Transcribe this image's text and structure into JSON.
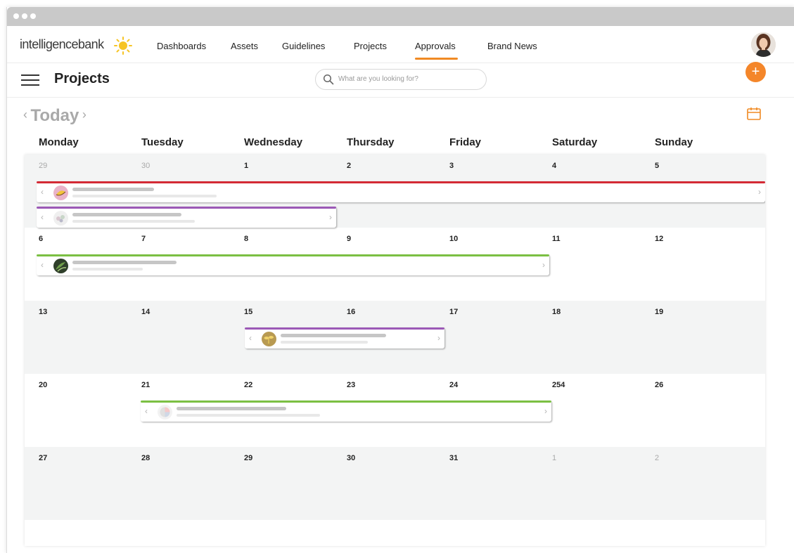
{
  "brand": {
    "name": "intelligencebank",
    "accent": "#f08a24",
    "sun_color": "#f6c423"
  },
  "nav": {
    "items": [
      {
        "label": "Dashboards"
      },
      {
        "label": "Assets"
      },
      {
        "label": "Guidelines"
      },
      {
        "label": "Projects"
      },
      {
        "label": "Approvals",
        "active": true
      },
      {
        "label": "Brand News"
      }
    ]
  },
  "header": {
    "title": "Projects",
    "menu_icon": "hamburger-icon",
    "add_icon": "plus-icon",
    "add_symbol": "+"
  },
  "search": {
    "placeholder": "What are you looking for?",
    "value": ""
  },
  "calendar": {
    "today_label": "Today",
    "prev_symbol": "‹",
    "next_symbol": "›",
    "days": [
      "Monday",
      "Tuesday",
      "Wednesday",
      "Thursday",
      "Friday",
      "Saturday",
      "Sunday"
    ],
    "weeks": [
      {
        "dates": [
          "29",
          "30",
          "1",
          "2",
          "3",
          "4",
          "5"
        ],
        "dim": [
          true,
          true,
          false,
          false,
          false,
          false,
          false
        ]
      },
      {
        "dates": [
          "6",
          "7",
          "8",
          "9",
          "10",
          "11",
          "12"
        ],
        "dim": [
          false,
          false,
          false,
          false,
          false,
          false,
          false
        ]
      },
      {
        "dates": [
          "13",
          "14",
          "15",
          "16",
          "17",
          "18",
          "19"
        ],
        "dim": [
          false,
          false,
          false,
          false,
          false,
          false,
          false
        ]
      },
      {
        "dates": [
          "20",
          "21",
          "22",
          "23",
          "24",
          "254",
          "26"
        ],
        "dim": [
          false,
          false,
          false,
          false,
          false,
          false,
          false
        ]
      },
      {
        "dates": [
          "27",
          "28",
          "29",
          "30",
          "31",
          "1",
          "2"
        ],
        "dim": [
          false,
          false,
          false,
          false,
          false,
          true,
          true
        ]
      }
    ],
    "events": [
      {
        "color": "#d42a35",
        "thumb": "banana"
      },
      {
        "color": "#9b59b6",
        "thumb": "flowers"
      },
      {
        "color": "#7bc043",
        "thumb": "leaves"
      },
      {
        "color": "#9b59b6",
        "thumb": "sprout"
      },
      {
        "color": "#7bc043",
        "thumb": "chart"
      }
    ],
    "colors": {
      "red": "#d42a35",
      "purple": "#9b59b6",
      "green": "#7bc043"
    }
  }
}
